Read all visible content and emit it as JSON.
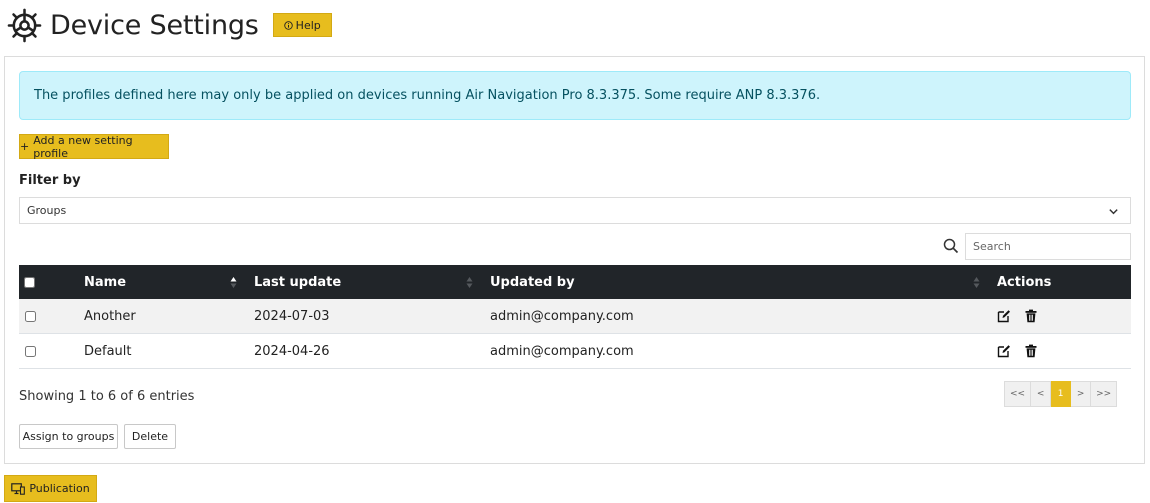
{
  "header": {
    "title": "Device Settings",
    "help_label": "Help",
    "icon": "gear-icon"
  },
  "alert": {
    "text": "The profiles defined here may only be applied on devices running Air Navigation Pro 8.3.375. Some require ANP 8.3.376."
  },
  "add_button": {
    "label": "Add a new setting profile",
    "icon": "plus-icon"
  },
  "filter": {
    "label": "Filter by",
    "selected": "Groups"
  },
  "search": {
    "placeholder": "Search",
    "icon": "search-icon"
  },
  "table": {
    "columns": [
      "Name",
      "Last update",
      "Updated by",
      "Actions"
    ],
    "rows": [
      {
        "name": "Another",
        "last_update": "2024-07-03",
        "updated_by": "admin@company.com"
      },
      {
        "name": "Default",
        "last_update": "2024-04-26",
        "updated_by": "admin@company.com"
      }
    ],
    "row_actions": [
      "edit-icon",
      "trash-icon"
    ]
  },
  "footer": {
    "info": "Showing 1 to 6 of 6 entries",
    "pagination": {
      "first": "<<",
      "prev": "<",
      "current": "1",
      "next": ">",
      "last": ">>"
    },
    "assign_label": "Assign to groups",
    "delete_label": "Delete"
  },
  "publication": {
    "label": "Publication",
    "icon": "monitor-icon"
  },
  "colors": {
    "accent": "#e7bd1e",
    "table_header": "#212529",
    "alert_bg": "#cef4fc",
    "alert_text": "#055160"
  }
}
